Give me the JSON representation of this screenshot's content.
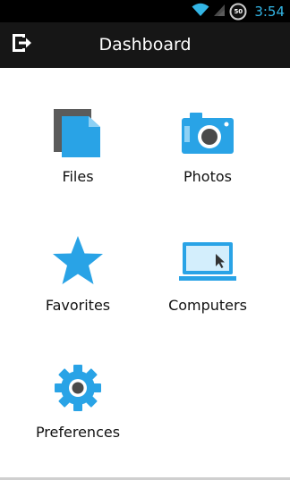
{
  "status_bar": {
    "time": "3:54",
    "battery_level": "50",
    "icons": [
      "wifi-icon",
      "signal-icon",
      "battery-icon"
    ],
    "accent_color": "#33b5e5"
  },
  "app_bar": {
    "title": "Dashboard",
    "exit_icon": "exit-icon",
    "background": "#161616"
  },
  "dashboard": {
    "accent_color": "#29a3e6",
    "items": [
      {
        "label": "Files",
        "icon": "files-icon"
      },
      {
        "label": "Photos",
        "icon": "camera-icon"
      },
      {
        "label": "Favorites",
        "icon": "star-icon"
      },
      {
        "label": "Computers",
        "icon": "laptop-icon"
      },
      {
        "label": "Preferences",
        "icon": "gear-icon"
      }
    ]
  }
}
